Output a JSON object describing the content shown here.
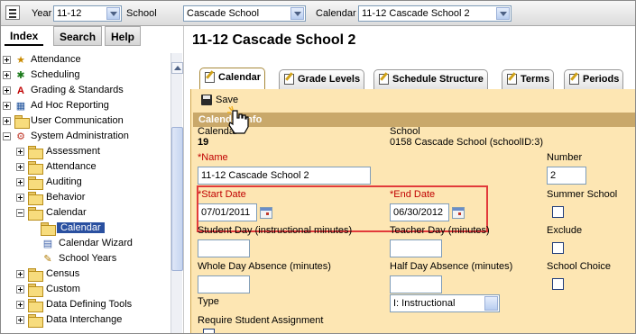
{
  "topbar": {
    "year_label": "Year",
    "year_value": "11-12",
    "school_label": "School",
    "school_value": "Cascade School",
    "calendar_label": "Calendar",
    "calendar_value": "11-12 Cascade School 2"
  },
  "nav": {
    "tabs": [
      "Index",
      "Search",
      "Help"
    ],
    "items": [
      {
        "label": "Attendance",
        "icon": "attendance-icon"
      },
      {
        "label": "Scheduling",
        "icon": "scheduling-icon"
      },
      {
        "label": "Grading & Standards",
        "icon": "grading-icon"
      },
      {
        "label": "Ad Hoc Reporting",
        "icon": "report-icon"
      },
      {
        "label": "User Communication",
        "icon": "folder-icon"
      },
      {
        "label": "System Administration",
        "icon": "system-admin-icon"
      },
      {
        "label": "Assessment",
        "icon": "folder-icon"
      },
      {
        "label": "Attendance",
        "icon": "folder-icon"
      },
      {
        "label": "Auditing",
        "icon": "folder-icon"
      },
      {
        "label": "Behavior",
        "icon": "folder-icon"
      },
      {
        "label": "Calendar",
        "icon": "folder-icon"
      },
      {
        "label": "Calendar",
        "icon": "open-folder-icon"
      },
      {
        "label": "Calendar Wizard",
        "icon": "wizard-icon"
      },
      {
        "label": "School Years",
        "icon": "edit-page-icon"
      },
      {
        "label": "Census",
        "icon": "folder-icon"
      },
      {
        "label": "Custom",
        "icon": "folder-icon"
      },
      {
        "label": "Data Defining Tools",
        "icon": "folder-icon"
      },
      {
        "label": "Data Interchange",
        "icon": "folder-icon"
      }
    ]
  },
  "main": {
    "title": "11-12 Cascade School 2",
    "tabs": [
      "Calendar",
      "Grade Levels",
      "Schedule Structure",
      "Terms",
      "Periods"
    ],
    "save_label": "Save",
    "section_title": "Calendar Info",
    "calendar_label": "Calendar",
    "calendar_id": "19",
    "school_label": "School",
    "school_value": "0158 Cascade School (schoolID:3)",
    "name_label": "*Name",
    "name_value": "11-12 Cascade School 2",
    "number_label": "Number",
    "number_value": "2",
    "start_date_label": "*Start Date",
    "start_date_value": "07/01/2011",
    "end_date_label": "*End Date",
    "end_date_value": "06/30/2012",
    "summer_school_label": "Summer School",
    "student_day_label": "Student Day (instructional minutes)",
    "teacher_day_label": "Teacher Day (minutes)",
    "exclude_label": "Exclude",
    "whole_day_label": "Whole Day Absence (minutes)",
    "half_day_label": "Half Day Absence (minutes)",
    "school_choice_label": "School Choice",
    "type_label": "Type",
    "type_value": "I: Instructional",
    "require_student_label": "Require Student Assignment"
  },
  "colors": {
    "panel_bg": "#fde6b3",
    "section_header": "#c9a86a",
    "selected_nav": "#2a50a0",
    "highlight": "#e23a3a",
    "required": "#c00000"
  }
}
